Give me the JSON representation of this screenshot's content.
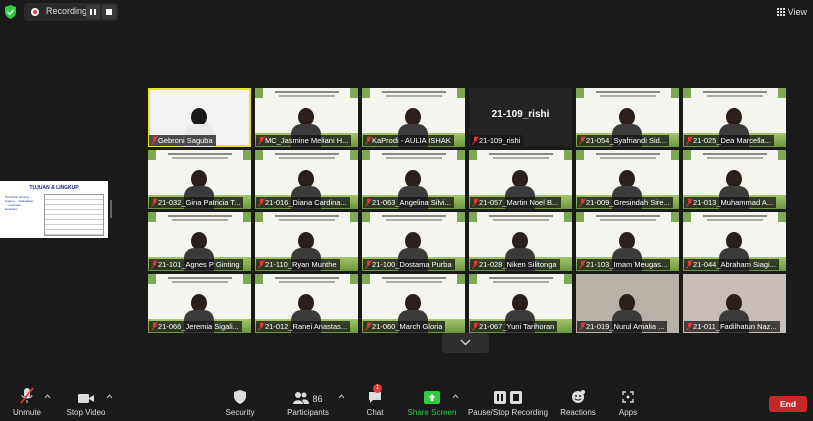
{
  "recording": {
    "label": "Recording..."
  },
  "view_label": "View",
  "shared_screen": {
    "title": "TUJUAN & LINGKUP",
    "text": "Penelitian tentang ... lingkup ... didasarkan ... pedoman ... kurikulum"
  },
  "participants": [
    {
      "name": "Gebroni Saguba",
      "type": "active"
    },
    {
      "name": "MC_Jasmine Meliani H...",
      "type": "slide"
    },
    {
      "name": "KaProdi - AULIA ISHAK",
      "type": "slide"
    },
    {
      "name": "21-109_rishi",
      "type": "dark",
      "center": "21-109_rishi"
    },
    {
      "name": "21-054_Syafriandi Sid...",
      "type": "slide"
    },
    {
      "name": "21-025_Dea Marcella...",
      "type": "slide"
    },
    {
      "name": "21-032_Gina Patricia T...",
      "type": "slide"
    },
    {
      "name": "21-016_Diana Cardina...",
      "type": "slide"
    },
    {
      "name": "21-063_Angelina Silvi...",
      "type": "slide"
    },
    {
      "name": "21-057_Martin Noel B...",
      "type": "slide"
    },
    {
      "name": "21-009_Gresindah Sire...",
      "type": "slide"
    },
    {
      "name": "21-013_Muhammad A...",
      "type": "slide"
    },
    {
      "name": "21-101_Agnes P Ginting",
      "type": "slide"
    },
    {
      "name": "21-110_Ryan Munthe",
      "type": "slide"
    },
    {
      "name": "21-100_Dostama Purba",
      "type": "slide"
    },
    {
      "name": "21-028_Niken Silitonga",
      "type": "slide"
    },
    {
      "name": "21-103_Imam Meugas...",
      "type": "slide"
    },
    {
      "name": "21-044_Abraham Siagi...",
      "type": "slide"
    },
    {
      "name": "21-066_Jeremia Sigali...",
      "type": "slide"
    },
    {
      "name": "21-012_Ranei Anastas...",
      "type": "slide"
    },
    {
      "name": "21-060_March Gloria",
      "type": "slide"
    },
    {
      "name": "21-067_Yuni Tarihoran",
      "type": "slide"
    },
    {
      "name": "21-019_Nurul Amalia ...",
      "type": "photo"
    },
    {
      "name": "21-011_Fadilhatun Naz...",
      "type": "photo2"
    }
  ],
  "toolbar": {
    "unmute": "Unmute",
    "stop_video": "Stop Video",
    "security": "Security",
    "participants": "Participants",
    "participants_count": "86",
    "chat": "Chat",
    "chat_badge": "1",
    "share_screen": "Share Screen",
    "pause_recording": "Pause/Stop Recording",
    "reactions": "Reactions",
    "apps": "Apps",
    "end": "End"
  },
  "colors": {
    "accent_green": "#2ecc40",
    "end_red": "#c62828",
    "highlight": "#e6e32c"
  }
}
